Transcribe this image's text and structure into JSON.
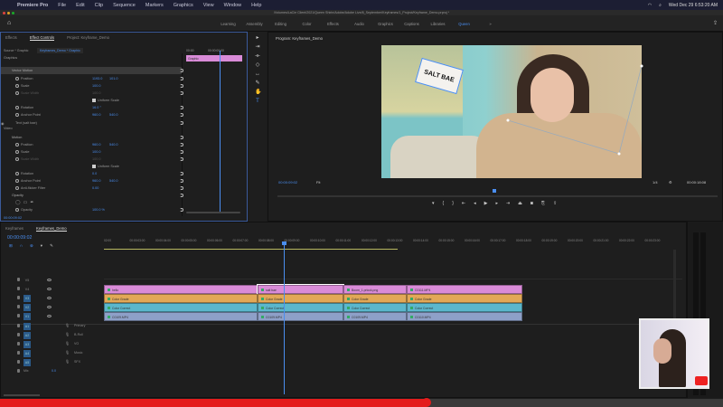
{
  "menubar": {
    "app": "Premiere Pro",
    "items": [
      "File",
      "Edit",
      "Clip",
      "Sequence",
      "Markers",
      "Graphics",
      "View",
      "Window",
      "Help"
    ],
    "datetime": "Wed Dec 29  6:53:20 AM"
  },
  "titlebar": {
    "path": "/Volumes/LaCie Client/2021/Queen Shirin/Adobe/Adobe Live/8_September/Keyframes/1_Project/Keyframe_Demo.prproj *"
  },
  "workspaces": {
    "items": [
      "Learning",
      "Assembly",
      "Editing",
      "Color",
      "Effects",
      "Audio",
      "Graphics",
      "Captions",
      "Libraries",
      "Queen"
    ],
    "active": "Queen",
    "more": "»"
  },
  "effect_controls": {
    "tabs": [
      "Effects",
      "Effect Controls",
      "Project: Keyframe_Demo"
    ],
    "source": "Source * Graphic",
    "clip": "Keyframes_Demo * Graphic",
    "ruler_start": "00:00",
    "ruler_mid": "00:00:00:00",
    "clip_bar": "Graphic",
    "timecode": "00:00:09:02",
    "sections": {
      "graphics": "Graphics",
      "video": "Video"
    },
    "rows": [
      {
        "label": "Vector Motion",
        "type": "fx"
      },
      {
        "label": "Position",
        "v1": "1193.0",
        "v2": "101.0"
      },
      {
        "label": "Scale",
        "v1": "100.0"
      },
      {
        "label": "Scale Width",
        "v1": "100.0",
        "dim": true
      },
      {
        "label": "Uniform Scale",
        "type": "check"
      },
      {
        "label": "Rotation",
        "v1": "16.0 °"
      },
      {
        "label": "Anchor Point",
        "v1": "960.0",
        "v2": "540.0"
      },
      {
        "label": "Text (salt bae)",
        "type": "eye"
      },
      {
        "label": "Motion",
        "type": "fx"
      },
      {
        "label": "Position",
        "v1": "960.0",
        "v2": "540.0"
      },
      {
        "label": "Scale",
        "v1": "100.0"
      },
      {
        "label": "Scale Width",
        "v1": "100.0",
        "dim": true
      },
      {
        "label": "Uniform Scale",
        "type": "check"
      },
      {
        "label": "Rotation",
        "v1": "0.0"
      },
      {
        "label": "Anchor Point",
        "v1": "960.0",
        "v2": "540.0"
      },
      {
        "label": "Anti-flicker Filter",
        "v1": "0.00"
      },
      {
        "label": "Opacity",
        "type": "fx"
      },
      {
        "label": "",
        "type": "masks"
      },
      {
        "label": "Opacity",
        "v1": "100.0 %"
      }
    ]
  },
  "program": {
    "title": "Program: Keyframes_Demo",
    "timecode": "00:00:09:02",
    "fit": "Fit",
    "resolution": "1/4",
    "duration": "00:00:18:08",
    "overlay_text": "SALT BAE"
  },
  "timeline": {
    "tabs": [
      "Keyframes",
      "Keyframes_Demo"
    ],
    "timecode": "00:00:09:02",
    "ruler": [
      "02:00",
      "00:00:03:00",
      "00:00:04:00",
      "00:00:05:00",
      "00:00:06:00",
      "00:00:07:00",
      "00:00:08:00",
      "00:00:09:00",
      "00:00:10:00",
      "00:00:11:00",
      "00:00:12:00",
      "00:00:13:00",
      "00:00:14:00",
      "00:00:15:00",
      "00:00:16:00",
      "00:00:17:00",
      "00:00:18:00",
      "00:00:19:00",
      "00:00:20:00",
      "00:00:21:00",
      "00:00:22:00",
      "00:00:23:00"
    ],
    "video_tracks": [
      "V5",
      "V4",
      "V3",
      "V2",
      "V1"
    ],
    "audio_tracks": [
      {
        "id": "A1",
        "name": "Primary"
      },
      {
        "id": "A2",
        "name": "B-Roll"
      },
      {
        "id": "A3",
        "name": "VO"
      },
      {
        "id": "A4",
        "name": "Music"
      },
      {
        "id": "A5",
        "name": "SFX"
      }
    ],
    "mix": {
      "label": "Mix",
      "value": "0.0"
    },
    "clips": [
      [
        "hello",
        "salt bae",
        "Boom_1.prlock.png",
        "C0111.MP4"
      ],
      [
        "Color Grade",
        "Color Grade",
        "Color Grade",
        "Color Grade"
      ],
      [
        "Color Correct",
        "Color Correct",
        "Color Correct",
        "Color Correct"
      ],
      [
        "C0109.MP4",
        "C0109.MP4",
        "C0109.MP4",
        "C0110.MP4"
      ]
    ],
    "progress_fraction": 0.59
  },
  "colors": {
    "accent": "#4a8ef0",
    "graphic": "#d98bd8",
    "grade": "#e2a857",
    "correct": "#5bb7cc",
    "video": "#8ea0c8"
  }
}
